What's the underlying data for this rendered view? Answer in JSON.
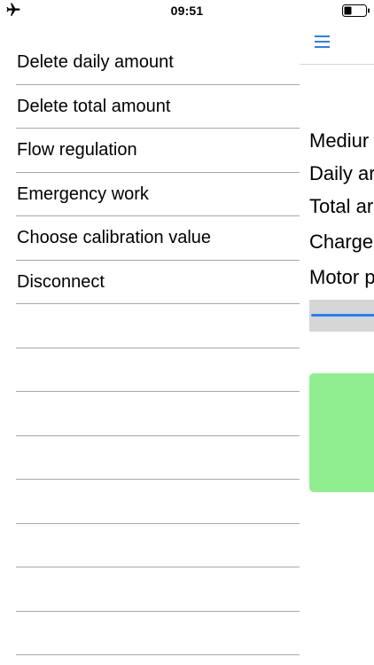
{
  "status_bar": {
    "time": "09:51",
    "icons": [
      "airplane-icon",
      "battery-icon"
    ]
  },
  "drawer": {
    "items": [
      {
        "label": "Delete daily amount"
      },
      {
        "label": "Delete total amount"
      },
      {
        "label": "Flow regulation"
      },
      {
        "label": "Emergency work"
      },
      {
        "label": "Choose calibration value"
      },
      {
        "label": "Disconnect"
      },
      {
        "label": ""
      },
      {
        "label": ""
      },
      {
        "label": ""
      },
      {
        "label": ""
      },
      {
        "label": ""
      },
      {
        "label": ""
      },
      {
        "label": ""
      },
      {
        "label": ""
      }
    ]
  },
  "main": {
    "menu_icon": "hamburger-icon",
    "lines": [
      "Mediur",
      "Daily ar",
      "Total ar",
      "Charge",
      "Motor p"
    ],
    "progress": 1.0,
    "colors": {
      "accent": "#2d7cf6",
      "green_panel": "#90ee90",
      "progress_track": "#d6d6d6"
    }
  }
}
